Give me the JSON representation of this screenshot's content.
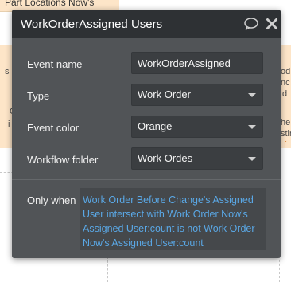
{
  "background": {
    "top_label": "Part Locations Now's",
    "left_fragments": [
      "s",
      "C",
      "i"
    ],
    "right_fragments": [
      "od",
      "nc",
      "d",
      "he",
      "stir",
      "f"
    ]
  },
  "modal": {
    "title": "WorkOrderAssigned Users",
    "header_icons": [
      "comment-icon",
      "close-icon"
    ],
    "fields": {
      "event_name": {
        "label": "Event name",
        "value": "WorkOrderAssigned"
      },
      "type": {
        "label": "Type",
        "value": "Work Order"
      },
      "event_color": {
        "label": "Event color",
        "value": "Orange"
      },
      "workflow_folder": {
        "label": "Workflow folder",
        "value": "Work Ordes"
      }
    },
    "only_when": {
      "label": "Only when",
      "condition": "Work Order Before Change's Assigned User intersect with Work Order Now's Assigned User:count is not Work Order Now's Assigned User:count"
    }
  },
  "colors": {
    "modal_bg": "#515457",
    "header_bg": "#2e3134",
    "field_bg": "#3b3e41",
    "condition_text": "#5aa8e6",
    "canvas_accent": "#fde5c8"
  }
}
